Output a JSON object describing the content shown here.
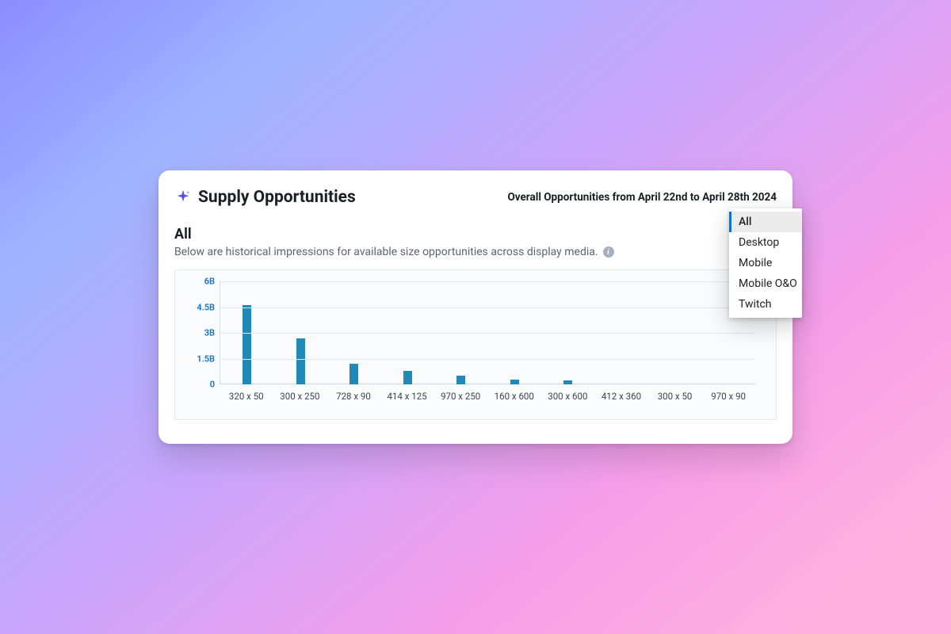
{
  "header": {
    "title": "Supply Opportunities",
    "date_range": "Overall Opportunities from April 22nd to April 28th 2024"
  },
  "section": {
    "title": "All",
    "description": "Below are historical impressions for available size opportunities across display media.",
    "info_glyph": "i"
  },
  "dropdown": {
    "options": [
      "All",
      "Desktop",
      "Mobile",
      "Mobile O&O",
      "Twitch"
    ],
    "selected": "All"
  },
  "chart_data": {
    "type": "bar",
    "title": "",
    "xlabel": "",
    "ylabel": "",
    "y_ticks": [
      "6B",
      "4.5B",
      "3B",
      "1.5B",
      "0"
    ],
    "ylim": [
      0,
      6
    ],
    "categories": [
      "320 x 50",
      "300 x 250",
      "728 x 90",
      "414 x 125",
      "970 x 250",
      "160 x 600",
      "300 x 600",
      "412 x 360",
      "300 x 50",
      "970 x 90"
    ],
    "values": [
      4.6,
      2.7,
      1.2,
      0.8,
      0.5,
      0.3,
      0.25,
      0,
      0,
      0
    ],
    "value_unit": "B",
    "bar_color": "#1f89b8"
  }
}
